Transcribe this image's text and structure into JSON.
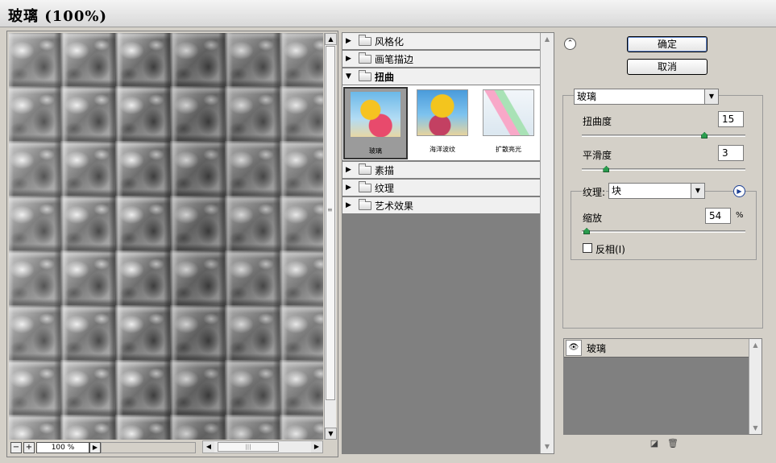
{
  "window": {
    "title": "玻璃 (100%)"
  },
  "preview": {
    "zoom_minus": "−",
    "zoom_plus": "+",
    "zoom_value": "100 %",
    "zoom_menu": "▶"
  },
  "gallery": {
    "categories": [
      {
        "label": "风格化",
        "expanded": false
      },
      {
        "label": "画笔描边",
        "expanded": false
      },
      {
        "label": "扭曲",
        "expanded": true
      },
      {
        "label": "素描",
        "expanded": false
      },
      {
        "label": "纹理",
        "expanded": false
      },
      {
        "label": "艺术效果",
        "expanded": false
      }
    ],
    "thumbnails": [
      {
        "label": "玻璃",
        "selected": true
      },
      {
        "label": "海洋波纹",
        "selected": false
      },
      {
        "label": "扩散亮光",
        "selected": false
      }
    ]
  },
  "buttons": {
    "ok": "确定",
    "cancel": "取消"
  },
  "settings": {
    "filter_select": "玻璃",
    "distortion": {
      "label": "扭曲度",
      "value": "15",
      "slider_fraction": 0.75
    },
    "smoothness": {
      "label": "平滑度",
      "value": "3",
      "slider_fraction": 0.15
    },
    "texture": {
      "label": "纹理:",
      "value": "块"
    },
    "scaling": {
      "label": "缩放",
      "value": "54",
      "unit": "%",
      "slider_fraction": 0.03
    },
    "invert": {
      "label": "反相(I)",
      "checked": false
    }
  },
  "layers": {
    "items": [
      {
        "label": "玻璃",
        "visible": true
      }
    ]
  },
  "colors": {
    "accent_knob": "#2a9c4e",
    "panel_bg": "#d4d0c8",
    "gallery_bg": "#808080"
  }
}
